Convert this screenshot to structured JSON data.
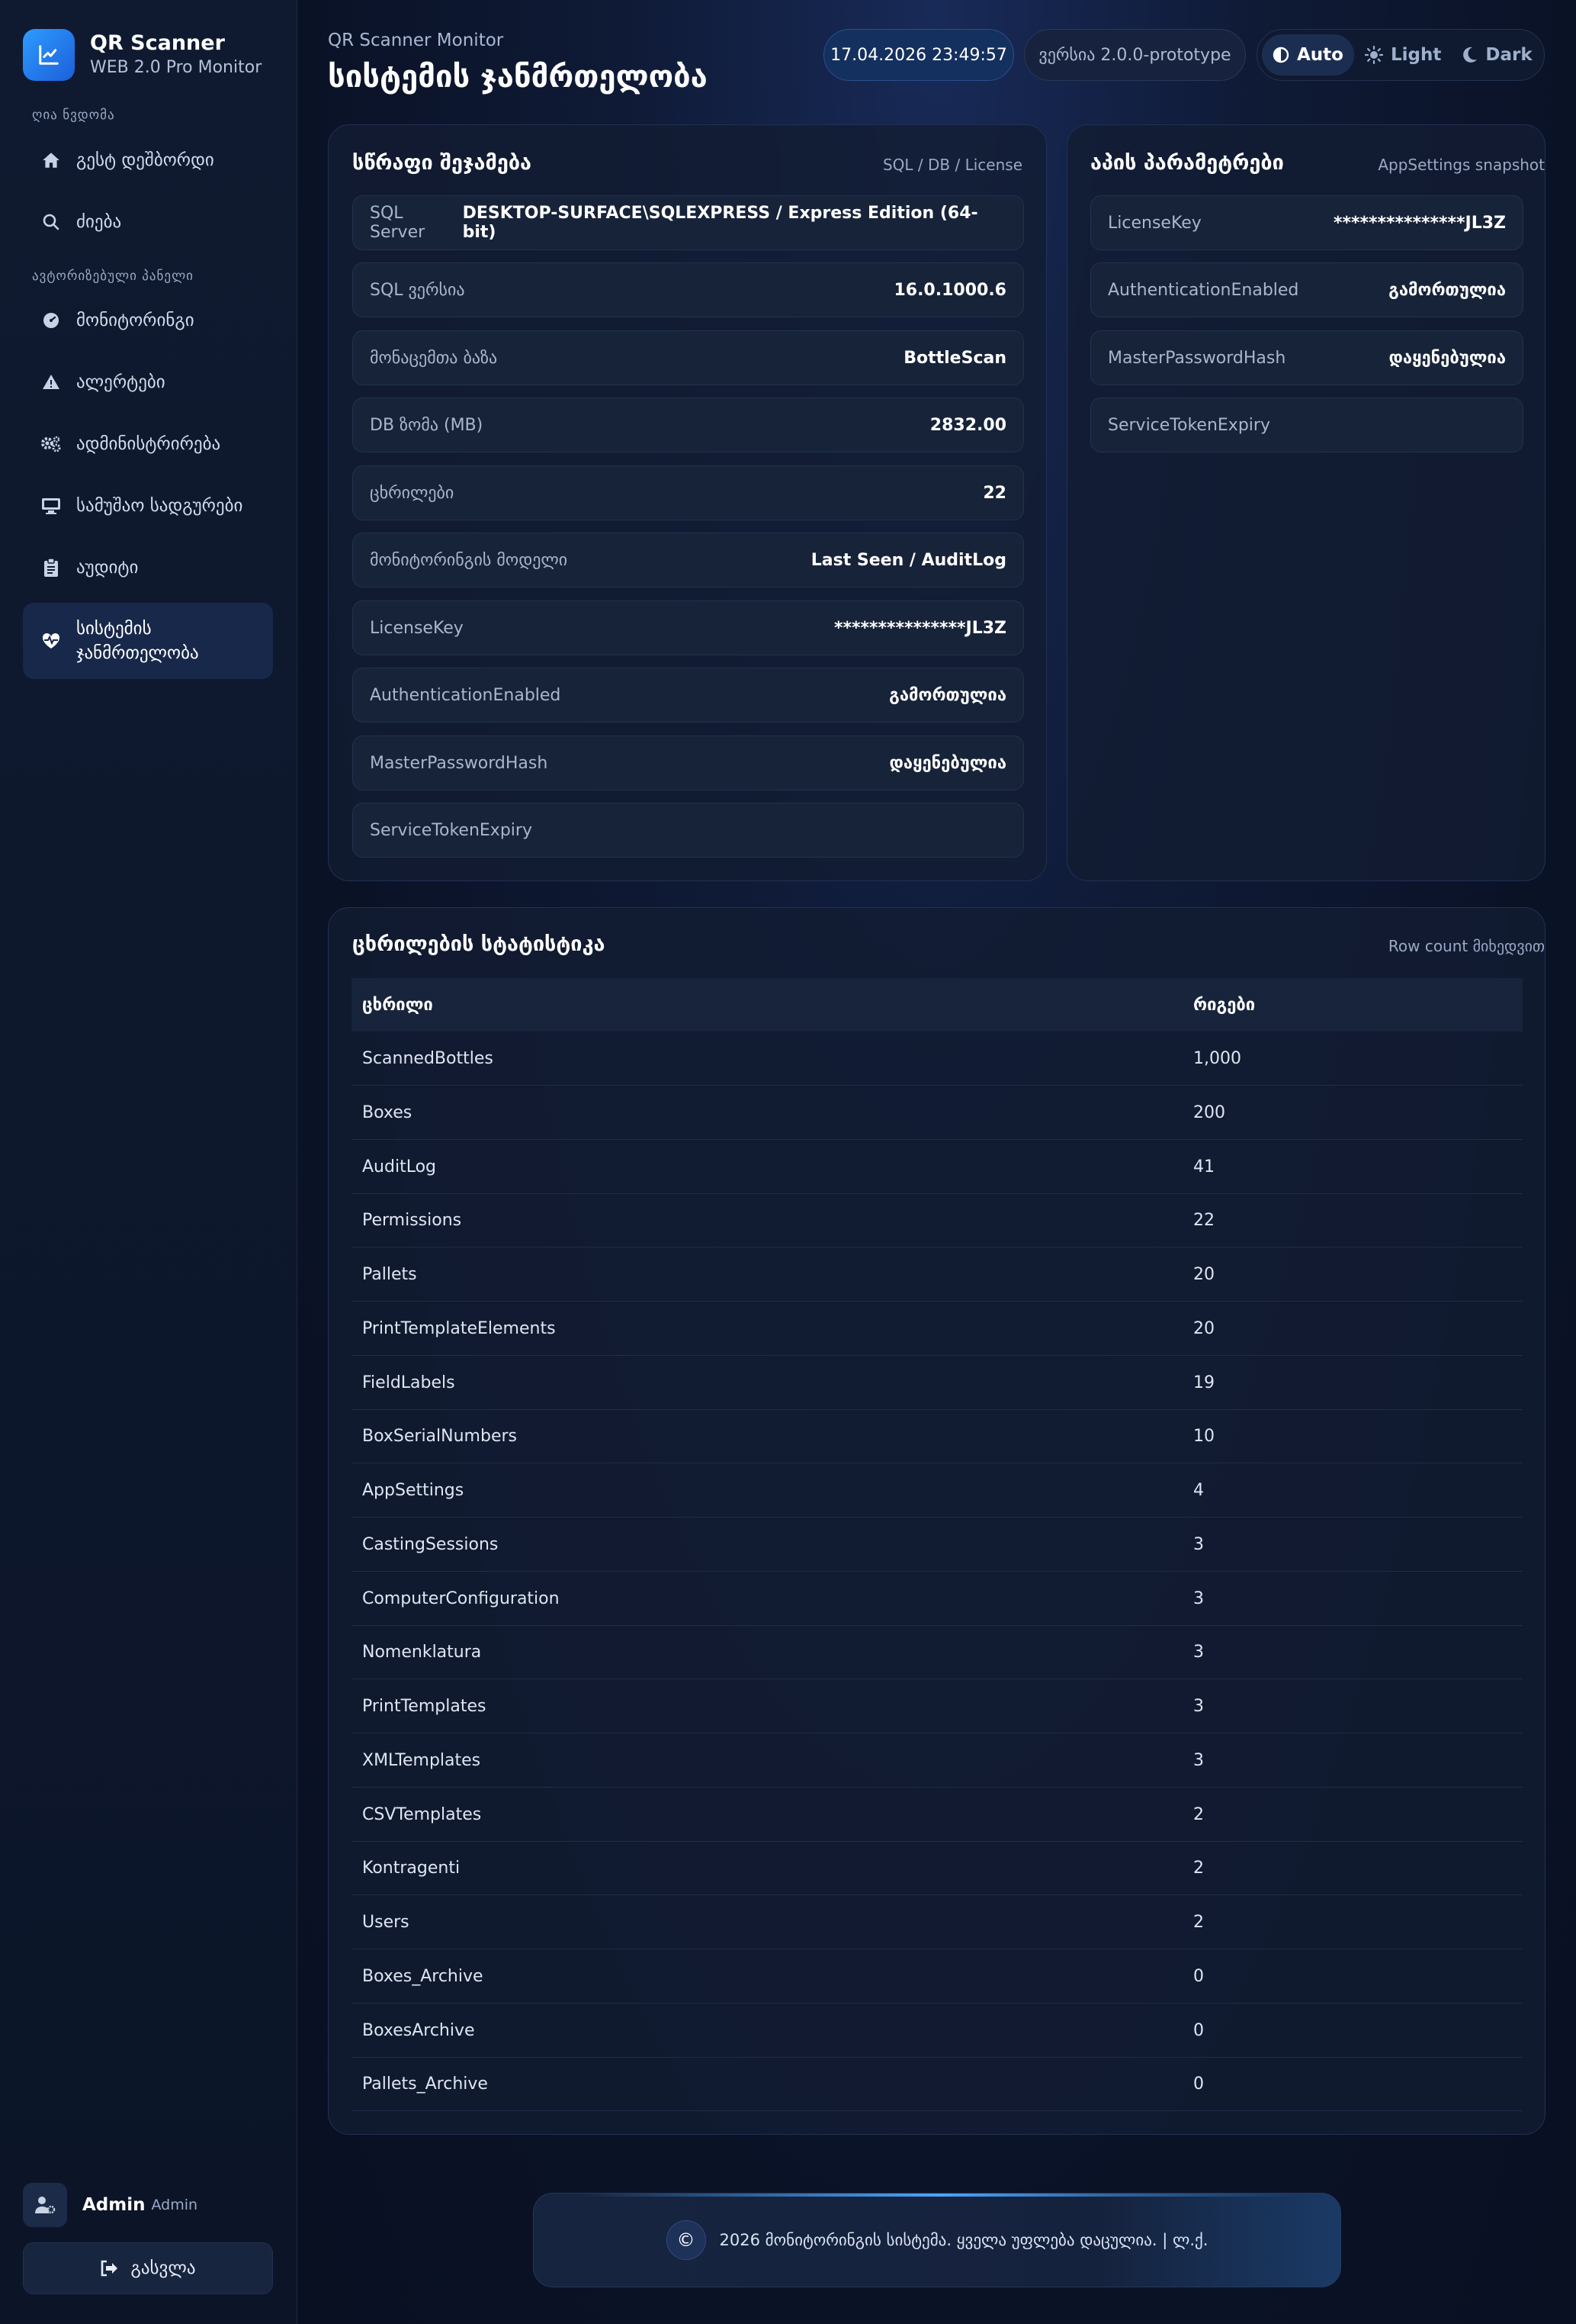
{
  "brand": {
    "title": "QR Scanner",
    "subtitle": "WEB 2.0 Pro Monitor"
  },
  "sidebar": {
    "section_open": "ღია ნვდომა",
    "section_auth": "ავტორიზებული პანელი",
    "items": [
      {
        "label": "გესტ დეშბორდი",
        "icon": "home-icon"
      },
      {
        "label": "ძიება",
        "icon": "search-icon"
      },
      {
        "label": "მონიტორინგი",
        "icon": "gauge-icon"
      },
      {
        "label": "ალერტები",
        "icon": "warning-icon"
      },
      {
        "label": "ადმინისტრირება",
        "icon": "gears-icon"
      },
      {
        "label": "სამუშაო სადგურები",
        "icon": "desktop-icon"
      },
      {
        "label": "აუდიტი",
        "icon": "clipboard-icon"
      },
      {
        "label": "სისტემის ჯანმრთელობა",
        "icon": "heart-pulse-icon"
      }
    ],
    "active_item": "სისტემის ჯანმრთელობა"
  },
  "user": {
    "name": "Admin",
    "role": "Admin"
  },
  "logout_label": "გასვლა",
  "header": {
    "kicker": "QR Scanner Monitor",
    "title": "სისტემის ჯანმრთელობა",
    "datetime": "17.04.2026 23:49:57",
    "version": "ვერსია 2.0.0-prototype"
  },
  "theme": {
    "options": [
      "Auto",
      "Light",
      "Dark"
    ],
    "selected": "Auto"
  },
  "quick_check": {
    "title": "სწრაფი შეჯამება",
    "meta": "SQL / DB / License",
    "rows": [
      {
        "key": "SQL Server",
        "value": "DESKTOP-SURFACE\\SQLEXPRESS / Express Edition (64-bit)"
      },
      {
        "key": "SQL ვერსია",
        "value": "16.0.1000.6"
      },
      {
        "key": "მონაცემთა ბაზა",
        "value": "BottleScan"
      },
      {
        "key": "DB ზომა (MB)",
        "value": "2832.00"
      },
      {
        "key": "ცხრილები",
        "value": "22"
      },
      {
        "key": "მონიტორინგის მოდელი",
        "value": "Last Seen / AuditLog"
      },
      {
        "key": "LicenseKey",
        "value": "***************JL3Z"
      },
      {
        "key": "AuthenticationEnabled",
        "value": "გამორთულია"
      },
      {
        "key": "MasterPasswordHash",
        "value": "დაყენებულია"
      },
      {
        "key": "ServiceTokenExpiry",
        "value": ""
      }
    ]
  },
  "app_settings": {
    "title": "აპის პარამეტრები",
    "meta": "AppSettings snapshot",
    "rows": [
      {
        "key": "LicenseKey",
        "value": "***************JL3Z"
      },
      {
        "key": "AuthenticationEnabled",
        "value": "გამორთულია"
      },
      {
        "key": "MasterPasswordHash",
        "value": "დაყენებულია"
      },
      {
        "key": "ServiceTokenExpiry",
        "value": ""
      }
    ]
  },
  "table_stats": {
    "title": "ცხრილების სტატისტიკა",
    "meta": "Row count მიხედვით",
    "columns": [
      "ცხრილი",
      "რიგები"
    ],
    "rows": [
      [
        "ScannedBottles",
        "1,000"
      ],
      [
        "Boxes",
        "200"
      ],
      [
        "AuditLog",
        "41"
      ],
      [
        "Permissions",
        "22"
      ],
      [
        "Pallets",
        "20"
      ],
      [
        "PrintTemplateElements",
        "20"
      ],
      [
        "FieldLabels",
        "19"
      ],
      [
        "BoxSerialNumbers",
        "10"
      ],
      [
        "AppSettings",
        "4"
      ],
      [
        "CastingSessions",
        "3"
      ],
      [
        "ComputerConfiguration",
        "3"
      ],
      [
        "Nomenklatura",
        "3"
      ],
      [
        "PrintTemplates",
        "3"
      ],
      [
        "XMLTemplates",
        "3"
      ],
      [
        "CSVTemplates",
        "2"
      ],
      [
        "Kontragenti",
        "2"
      ],
      [
        "Users",
        "2"
      ],
      [
        "Boxes_Archive",
        "0"
      ],
      [
        "BoxesArchive",
        "0"
      ],
      [
        "Pallets_Archive",
        "0"
      ]
    ]
  },
  "footer": {
    "text": "2026 მონიტორინგის სისტემა. ყველა უფლება დაცულია. | ლ.ქ.",
    "badge": "©"
  },
  "colors": {
    "accent": "#2f9bff",
    "background": "#0b1427",
    "card": "#121c32",
    "active_nav": "#17284a"
  }
}
